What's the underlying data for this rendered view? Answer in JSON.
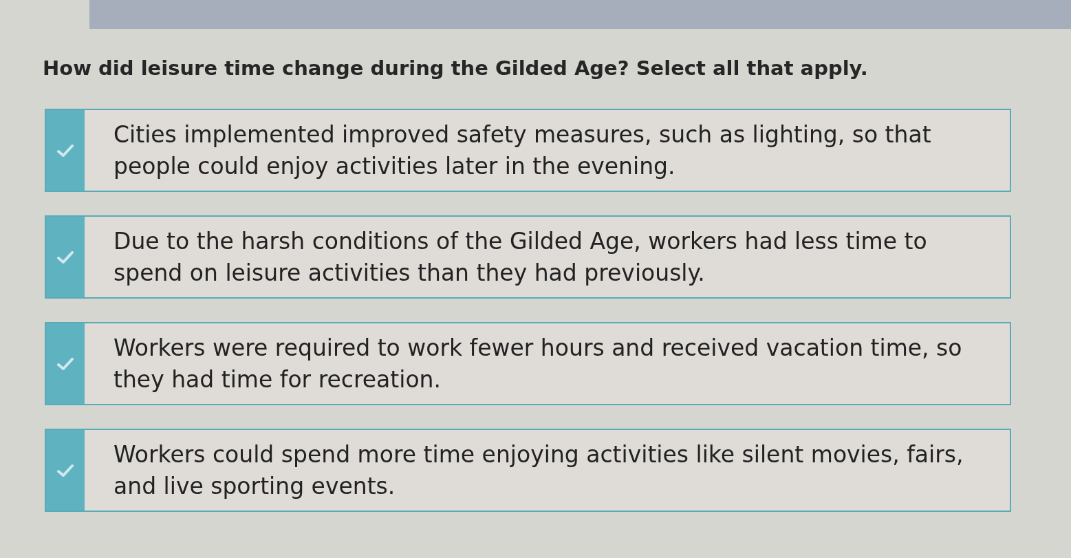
{
  "question": "How did leisure time change during the Gilded Age? Select all that apply.",
  "options": [
    {
      "text": "Cities implemented improved safety measures, such as lighting, so that people could enjoy activities later in the evening.",
      "selected": false
    },
    {
      "text": "Due to the harsh conditions of the Gilded Age, workers had less time to spend on leisure activities than they had previously.",
      "selected": false
    },
    {
      "text": "Workers were required to work fewer hours and received vacation time, so they had time for recreation.",
      "selected": false
    },
    {
      "text": "Workers could spend more time enjoying activities like silent movies, fairs, and live sporting events.",
      "selected": false
    }
  ]
}
